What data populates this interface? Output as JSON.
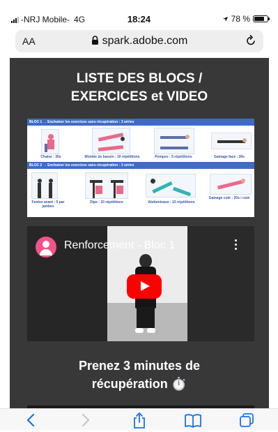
{
  "status_bar": {
    "carrier": "-NRJ Mobile-",
    "network": "4G",
    "time": "18:24",
    "battery_pct": "78 %",
    "battery_level": 0.78
  },
  "url_bar": {
    "text_size_label": "AA",
    "url": "spark.adobe.com"
  },
  "page": {
    "title_line1": "LISTE DES BLOCS /",
    "title_line2": "EXERCICES et VIDEO",
    "exercise_image": {
      "bloc1_header": "BLOC 1 → Enchainer les exercices sans récupération : 3 séries",
      "bloc1_exercises": [
        "Chaise : 30s",
        "Montée de bassin : 10 répétitions",
        "Pompes : 5 répétitions",
        "Gainage face : 30s"
      ],
      "bloc2_header": "BLOC 2 → Enchainer les exercices sans récupération : 3 séries",
      "bloc2_exercises": [
        "Fentes avant : 5 par jambes",
        "Dips : 10 répétitions",
        "Abdominaux : 15 répétitions",
        "Gainage coté : 20s / coté"
      ]
    },
    "video": {
      "title": "Renforcement - Bloc 1"
    },
    "subtitle_line1": "Prenez 3 minutes de",
    "subtitle_line2": "récupération ⏱️"
  },
  "toolbar": {
    "icons": [
      "back-icon",
      "forward-icon",
      "share-icon",
      "bookmarks-icon",
      "tabs-icon"
    ]
  },
  "colors": {
    "page_bg": "#383838",
    "bloc_header": "#3f6bc7",
    "play_button": "#ff0000",
    "safari_blue": "#1a73e8"
  }
}
